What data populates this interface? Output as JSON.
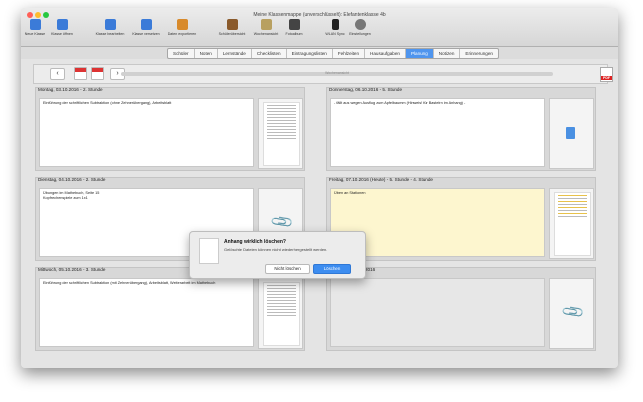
{
  "window": {
    "title": "Meine Klassenmappe (unverschlüsselt): Elefantenklasse 4b"
  },
  "toolbar": {
    "items": [
      {
        "label": "Neue Klasse",
        "icon": "class-add-icon",
        "color": "#3b7bd8"
      },
      {
        "label": "Klasse öffnen",
        "icon": "class-open-icon",
        "color": "#3b7bd8"
      },
      {
        "label": "Klasse bearbeiten",
        "icon": "class-edit-icon",
        "color": "#3b7bd8"
      },
      {
        "label": "Klasse versetzen",
        "icon": "class-move-icon",
        "color": "#3b7bd8"
      },
      {
        "label": "Daten exportieren",
        "icon": "export-icon",
        "color": "#d88a2b"
      },
      {
        "label": "Schülerübersicht",
        "icon": "students-icon",
        "color": "#8a5a2b"
      },
      {
        "label": "Wochenansicht",
        "icon": "week-view-icon",
        "color": "#b8a060"
      },
      {
        "label": "Fotoalbum",
        "icon": "camera-icon",
        "color": "#444444"
      },
      {
        "label": "WLAN Sync",
        "icon": "phone-icon",
        "color": "#222222"
      },
      {
        "label": "Einstellungen",
        "icon": "gear-icon",
        "color": "#777777"
      }
    ]
  },
  "tabs": [
    {
      "label": "Schüler",
      "selected": false
    },
    {
      "label": "Noten",
      "selected": false
    },
    {
      "label": "Lernstände",
      "selected": false
    },
    {
      "label": "Checklisten",
      "selected": false
    },
    {
      "label": "Eintragungslisten",
      "selected": false
    },
    {
      "label": "Fehlzeiten",
      "selected": false
    },
    {
      "label": "Hausaufgaben",
      "selected": false
    },
    {
      "label": "Planung",
      "selected": true
    },
    {
      "label": "Notizen",
      "selected": false
    },
    {
      "label": "Erinnerungen",
      "selected": false
    }
  ],
  "nav": {
    "prev": "‹",
    "next": "›",
    "status": "Wochenansicht",
    "pdf": "PDF"
  },
  "days": [
    {
      "header": "Montag, 03.10.2016 - 2. Stunde",
      "note": "Einführung der schriftlichen Subtraktion (ohne Zehnerübergang), Arbeitsblatt"
    },
    {
      "header": "Donnerstag, 06.10.2016 - 5. Stunde",
      "note": "- fällt aus wegen Ausflug zum Apfelbaumm (Hinweis! für Bastelrn im Anhang) -"
    },
    {
      "header": "Dienstag, 04.10.2016 - 2. Stunde",
      "note": "Übungen im Mathebuch, Seite 15\nKopfrechenspiele zum 1x1"
    },
    {
      "header": "Freitag, 07.10.2016 (Heute) - 5. Stunde - 4. Stunde",
      "note": "Üben an Stationen"
    },
    {
      "header": "Mittwoch, 05.10.2016 - 3. Stunde",
      "note": "Einführung der schriftlichen Subtraktion (mit Zehnerübergang), Arbeitsblatt, Weiterarbeit im Mathebuch"
    },
    {
      "header": "2016",
      "note": ""
    }
  ],
  "dialog": {
    "title": "Anhang wirklich löschen?",
    "message": "Gelöschte Dateien können nicht wiederhergestellt werden.",
    "cancel": "Nicht löschen",
    "confirm": "Löschen"
  }
}
